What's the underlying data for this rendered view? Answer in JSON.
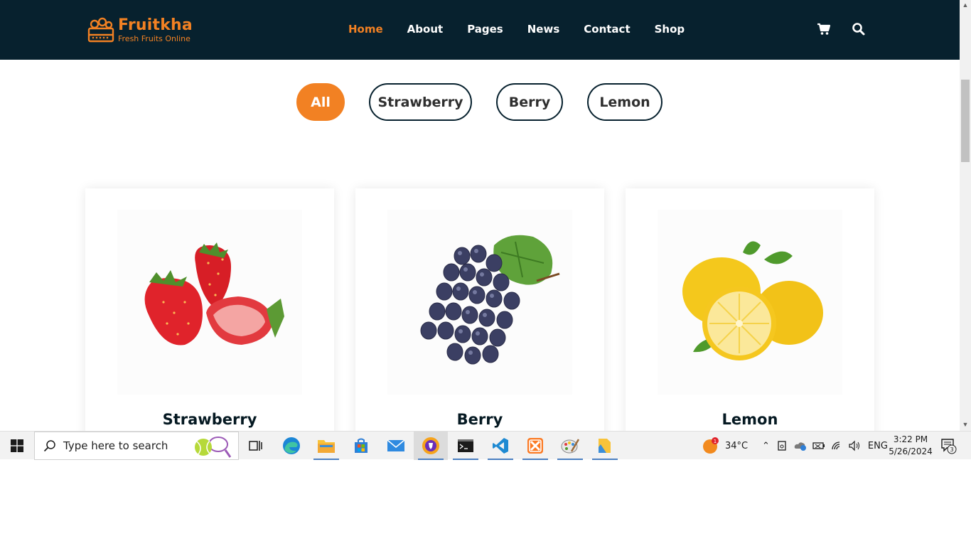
{
  "brand": {
    "name": "Fruitkha",
    "tagline": "Fresh Fruits Online",
    "accent": "#f28123",
    "header_bg": "#07212e"
  },
  "nav": {
    "items": [
      {
        "label": "Home",
        "active": true
      },
      {
        "label": "About"
      },
      {
        "label": "Pages"
      },
      {
        "label": "News"
      },
      {
        "label": "Contact"
      },
      {
        "label": "Shop"
      }
    ],
    "cart_icon": "cart-icon",
    "search_icon": "search-icon"
  },
  "filters": [
    {
      "label": "All",
      "active": true
    },
    {
      "label": "Strawberry"
    },
    {
      "label": "Berry"
    },
    {
      "label": "Lemon"
    }
  ],
  "products": [
    {
      "name": "Strawberry",
      "image": "strawberry-image"
    },
    {
      "name": "Berry",
      "image": "grapes-image"
    },
    {
      "name": "Lemon",
      "image": "lemon-image"
    }
  ],
  "taskbar": {
    "search_placeholder": "Type here to search",
    "weather": "34°C",
    "language": "ENG",
    "time": "3:22 PM",
    "date": "5/26/2024",
    "notification_count": "3",
    "weather_alert_count": "1",
    "apps": [
      "task-view",
      "edge",
      "file-explorer",
      "microsoft-store",
      "mail",
      "brave",
      "terminal",
      "vscode",
      "xampp",
      "paint",
      "file-manager"
    ]
  }
}
